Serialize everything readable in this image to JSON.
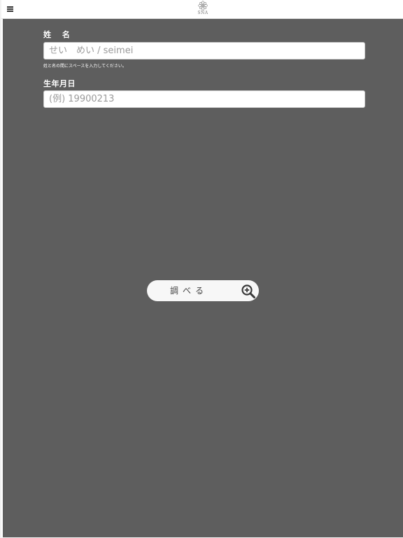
{
  "header": {
    "menu_icon": "hamburger-menu-icon",
    "logo_text": "SNA"
  },
  "form": {
    "name_label": "姓 名",
    "name_placeholder": "せい　めい / seimei",
    "name_hint": "姓と名の間にスペースを入力してください。",
    "birth_label": "生年月日",
    "birth_placeholder": "(例) 19900213"
  },
  "search": {
    "label": "調べる",
    "icon": "magnifier-plus-icon"
  },
  "colors": {
    "background": "#5e5e5e",
    "topbar": "#ffffff",
    "button": "#f7f7f7",
    "text_light": "#ffffff"
  }
}
